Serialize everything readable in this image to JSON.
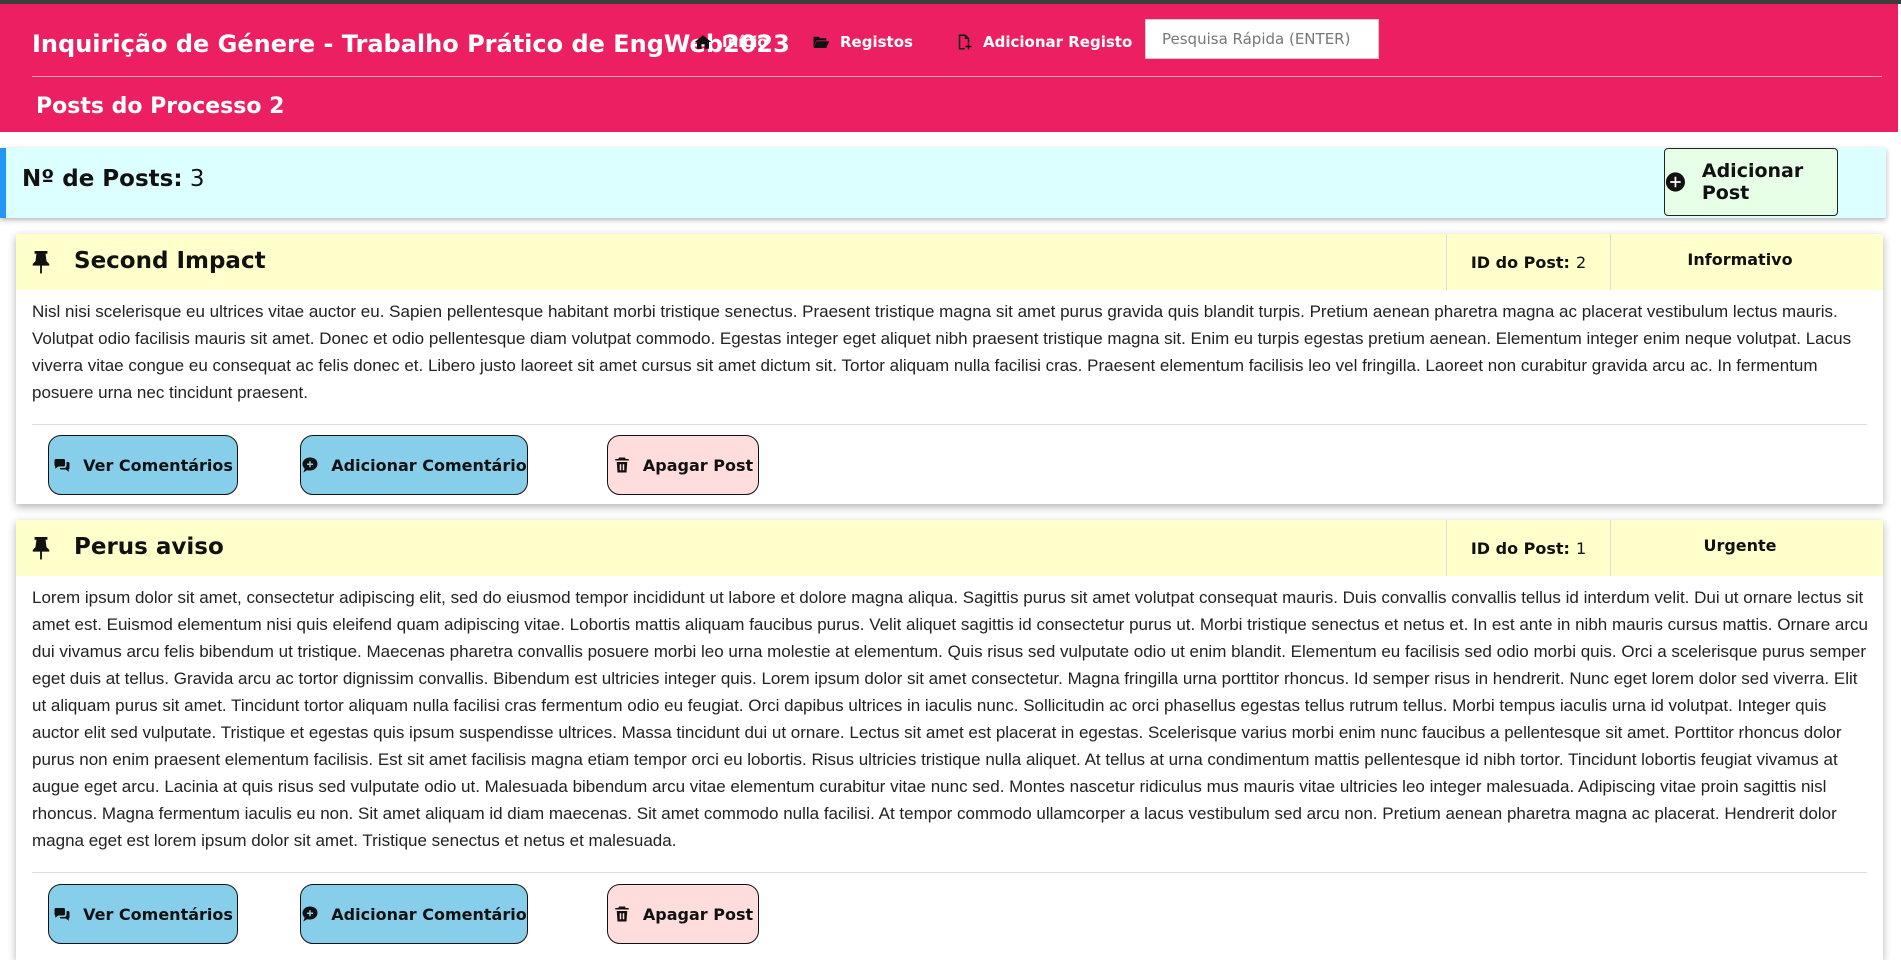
{
  "navbar": {
    "brand": "Inquirição de Génere - Trabalho Prático de EngWeb2023",
    "links": [
      {
        "label": "Início",
        "icon": "home-icon"
      },
      {
        "label": "Registos",
        "icon": "folder-open-icon"
      },
      {
        "label": "Adicionar Registo",
        "icon": "file-add-icon"
      }
    ],
    "search_placeholder": "Pesquisa Rápida (ENTER)",
    "color": "#ec1f63"
  },
  "page": {
    "subtitle": "Posts do Processo 2"
  },
  "summary": {
    "count_label": "Nº de Posts:",
    "count_value": "3",
    "add_post_label": "Adicionar Post"
  },
  "posts": [
    {
      "title": "Second Impact",
      "id_label": "ID do Post:",
      "id_value": "2",
      "type": "Informativo",
      "body": "Nisl nisi scelerisque eu ultrices vitae auctor eu. Sapien pellentesque habitant morbi tristique senectus. Praesent tristique magna sit amet purus gravida quis blandit turpis. Pretium aenean pharetra magna ac placerat vestibulum lectus mauris. Volutpat odio facilisis mauris sit amet. Donec et odio pellentesque diam volutpat commodo. Egestas integer eget aliquet nibh praesent tristique magna sit. Enim eu turpis egestas pretium aenean. Elementum integer enim neque volutpat. Lacus viverra vitae congue eu consequat ac felis donec et. Libero justo laoreet sit amet cursus sit amet dictum sit. Tortor aliquam nulla facilisi cras. Praesent elementum facilisis leo vel fringilla. Laoreet non curabitur gravida arcu ac. In fermentum posuere urna nec tincidunt praesent.",
      "buttons": {
        "view_comments": "Ver Comentários",
        "add_comment": "Adicionar Comentário",
        "delete": "Apagar Post"
      }
    },
    {
      "title": "Perus aviso",
      "id_label": "ID do Post:",
      "id_value": "1",
      "type": "Urgente",
      "body": "Lorem ipsum dolor sit amet, consectetur adipiscing elit, sed do eiusmod tempor incididunt ut labore et dolore magna aliqua. Sagittis purus sit amet volutpat consequat mauris. Duis convallis convallis tellus id interdum velit. Dui ut ornare lectus sit amet est. Euismod elementum nisi quis eleifend quam adipiscing vitae. Lobortis mattis aliquam faucibus purus. Velit aliquet sagittis id consectetur purus ut. Morbi tristique senectus et netus et. In est ante in nibh mauris cursus mattis. Ornare arcu dui vivamus arcu felis bibendum ut tristique. Maecenas pharetra convallis posuere morbi leo urna molestie at elementum. Quis risus sed vulputate odio ut enim blandit. Elementum eu facilisis sed odio morbi quis. Orci a scelerisque purus semper eget duis at tellus. Gravida arcu ac tortor dignissim convallis. Bibendum est ultricies integer quis. Lorem ipsum dolor sit amet consectetur. Magna fringilla urna porttitor rhoncus. Id semper risus in hendrerit. Nunc eget lorem dolor sed viverra. Elit ut aliquam purus sit amet. Tincidunt tortor aliquam nulla facilisi cras fermentum odio eu feugiat. Orci dapibus ultrices in iaculis nunc. Sollicitudin ac orci phasellus egestas tellus rutrum tellus. Morbi tempus iaculis urna id volutpat. Integer quis auctor elit sed vulputate. Tristique et egestas quis ipsum suspendisse ultrices. Massa tincidunt dui ut ornare. Lectus sit amet est placerat in egestas. Scelerisque varius morbi enim nunc faucibus a pellentesque sit amet. Porttitor rhoncus dolor purus non enim praesent elementum facilisis. Est sit amet facilisis magna etiam tempor orci eu lobortis. Risus ultricies tristique nulla aliquet. At tellus at urna condimentum mattis pellentesque id nibh tortor. Tincidunt lobortis feugiat vivamus at augue eget arcu. Lacinia at quis risus sed vulputate odio ut. Malesuada bibendum arcu vitae elementum curabitur vitae nunc sed. Montes nascetur ridiculus mus mauris vitae ultricies leo integer malesuada. Adipiscing vitae proin sagittis nisl rhoncus. Magna fermentum iaculis eu non. Sit amet aliquam id diam maecenas. Sit amet commodo nulla facilisi. At tempor commodo ullamcorper a lacus vestibulum sed arcu non. Pretium aenean pharetra magna ac placerat. Hendrerit dolor magna eget est lorem ipsum dolor sit amet. Tristique senectus et netus et malesuada.",
      "buttons": {
        "view_comments": "Ver Comentários",
        "add_comment": "Adicionar Comentário",
        "delete": "Apagar Post"
      }
    }
  ]
}
